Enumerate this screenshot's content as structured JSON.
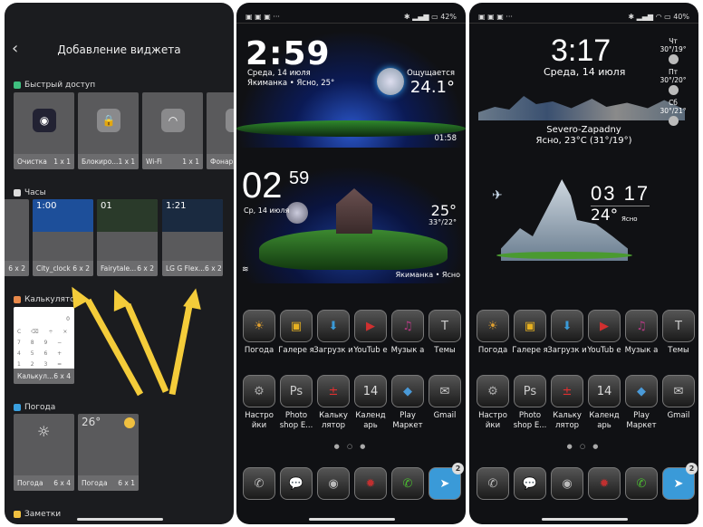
{
  "left": {
    "title": "Добавление виджета",
    "sections": [
      {
        "label": "Быстрый доступ",
        "color": "#3fbf7f",
        "cards": [
          {
            "name": "Очистка",
            "size": "1 x 1"
          },
          {
            "name": "Блокиро...",
            "size": "1 x 1"
          },
          {
            "name": "Wi-Fi",
            "size": "1 x 1"
          },
          {
            "name": "Фонар",
            "size": ""
          }
        ]
      },
      {
        "label": "Часы",
        "color": "#dddddd",
        "cards": [
          {
            "name": "...",
            "size": "6 x 2"
          },
          {
            "name": "City_clock",
            "size": "6 x 2"
          },
          {
            "name": "Fairytale...",
            "size": "6 x 2"
          },
          {
            "name": "LG G Flex...",
            "size": "6 x 2"
          }
        ]
      },
      {
        "label": "Калькулятор",
        "color": "#e8894a",
        "cards": [
          {
            "name": "Калькул...",
            "size": "6 x 4"
          }
        ]
      },
      {
        "label": "Погода",
        "color": "#3aa0e0",
        "cards": [
          {
            "name": "Погода",
            "size": "6 x 4"
          },
          {
            "name": "Погода",
            "size": "6 x 1"
          }
        ]
      },
      {
        "label": "Заметки",
        "color": "#f0c040"
      }
    ],
    "preview_texts": {
      "city_clock_time": "1:00",
      "fairytale_time": "01",
      "lg_time": "1:21",
      "weather_temp": "26°",
      "calc_display": "0",
      "calc_keys": "C ⌫ ÷ × 7 8 9 − 4 5 6 + 1 2 3 ="
    }
  },
  "middle": {
    "status": {
      "battery": "42%"
    },
    "w1": {
      "time": "2:59",
      "date": "Среда, 14 июля",
      "loc": "Якиманка • Ясно, 25°",
      "feels_label": "Ощущается",
      "feels": "24.1°",
      "alarm": "01:58"
    },
    "w2": {
      "hour": "02",
      "min": "59",
      "date": "Ср, 14 июля",
      "temp": "25°",
      "range": "33°/22°",
      "loc": "Якиманка • Ясно"
    }
  },
  "right": {
    "status": {
      "battery": "40%"
    },
    "w1": {
      "time": "3:17",
      "date": "Среда, 14 июля",
      "city": "Severo-Zapadny",
      "cond": "Ясно, 23°C (31°/19°)",
      "forecast": [
        {
          "day": "Чт",
          "t": "30°/19°"
        },
        {
          "day": "Пт",
          "t": "30°/20°"
        },
        {
          "day": "Сб",
          "t": "30°/21°"
        }
      ]
    },
    "w2": {
      "time": "03 17",
      "temp": "24°",
      "cond": "Ясно"
    }
  },
  "apps": [
    {
      "label": "Погода",
      "glyph": "☀",
      "color": "#e0a030"
    },
    {
      "label": "Галере я",
      "glyph": "▣",
      "color": "#e6b020"
    },
    {
      "label": "Загрузк и",
      "glyph": "⬇",
      "color": "#3a9ad8"
    },
    {
      "label": "YouTub e",
      "glyph": "▶",
      "color": "#d03030"
    },
    {
      "label": "Музык а",
      "glyph": "♫",
      "color": "#b03a80"
    },
    {
      "label": "Темы",
      "glyph": "T",
      "color": "#ccc"
    },
    {
      "label": "Настро йки",
      "glyph": "⚙",
      "color": "#aaa"
    },
    {
      "label": "Photo shop E...",
      "glyph": "Ps",
      "color": "#ccc"
    },
    {
      "label": "Кальку лятор",
      "glyph": "±",
      "color": "#e03030"
    },
    {
      "label": "Календ арь",
      "glyph": "14",
      "color": "#ddd"
    },
    {
      "label": "Play Маркет",
      "glyph": "◆",
      "color": "#4a9ad8"
    },
    {
      "label": "Gmail",
      "glyph": "✉",
      "color": "#ccc"
    }
  ],
  "calendar_day": "Среда",
  "dock": [
    {
      "name": "phone",
      "glyph": "✆",
      "color": "#bbb"
    },
    {
      "name": "messages",
      "glyph": "💬",
      "color": "#bbb"
    },
    {
      "name": "camera",
      "glyph": "◉",
      "color": "#bbb"
    },
    {
      "name": "browser",
      "glyph": "✹",
      "color": "#c03030"
    },
    {
      "name": "whatsapp",
      "glyph": "✆",
      "color": "#4ab830"
    },
    {
      "name": "telegram",
      "glyph": "➤",
      "color": "#fff",
      "badge": "2"
    }
  ],
  "arrow_color": "#f4cc3a"
}
